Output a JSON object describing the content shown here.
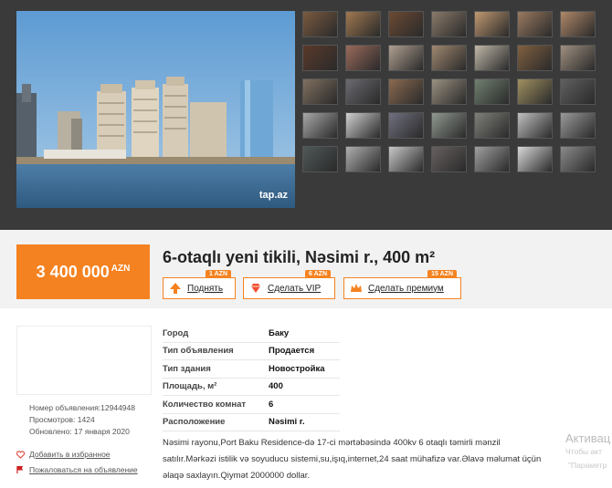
{
  "gallery": {
    "watermark": "tap.az",
    "thumb_colors": [
      "#7a5a40",
      "#a07850",
      "#6b4a33",
      "#8a7a6a",
      "#c09870",
      "#9a7a60",
      "#b08868",
      "#5a3a2a",
      "#9a6a5a",
      "#b0a090",
      "#a08870",
      "#c0b8a8",
      "#806040",
      "#a09080",
      "#807060",
      "#6a6a70",
      "#8a6a50",
      "#9a9080",
      "#708070",
      "#a09060",
      "#606060",
      "#a8a8a8",
      "#d0d0d0",
      "#707080",
      "#909890",
      "#80807a",
      "#c0c0c0",
      "#9a9a9a",
      "#505858",
      "#b0b0b0",
      "#c8c8c8",
      "#686060",
      "#a0a0a0",
      "#d8d8d8",
      "#8a8a8a"
    ]
  },
  "listing": {
    "price": "3 400 000",
    "currency": "AZN",
    "title": "6-otaqlı yeni tikili, Nəsimi r., 400 m²"
  },
  "promotions": {
    "raise": {
      "label": "Поднять",
      "badge": "1 AZN"
    },
    "vip": {
      "label": "Сделать VIP",
      "badge": "6 AZN"
    },
    "premium": {
      "label": "Сделать премиум",
      "badge": "15 AZN"
    }
  },
  "meta": {
    "ad_number": "Номер объявления:12944948",
    "views": "Просмотров: 1424",
    "updated": "Обновлено: 17 января 2020",
    "favorite": "Добавить в избранное",
    "report": "Пожаловаться на объявление"
  },
  "properties": [
    {
      "key": "Город",
      "value": "Баку"
    },
    {
      "key": "Тип объявления",
      "value": "Продается"
    },
    {
      "key": "Тип здания",
      "value": "Новостройка"
    },
    {
      "key": "Площадь, м²",
      "value": "400"
    },
    {
      "key": "Количество комнат",
      "value": "6"
    },
    {
      "key": "Расположение",
      "value": "Nəsimi r."
    }
  ],
  "description": {
    "line1": "Nəsimi rayonu,Port Baku Residence-də 17-ci mərtəbəsində 400kv 6 otaqlı təmirli mənzil",
    "line2": "satılır.Mərkəzi istilik və soyuducu sistemi,su,işıq,internet,24 saat mühafizə var.Əlavə məlumat üçün",
    "line3": "əlaqə saxlayın.Qiymət 2000000 dollar."
  },
  "overlay": {
    "title": "Активац",
    "line1": "Чтобы акт",
    "line2": "\"Параметр"
  },
  "colors": {
    "accent": "#f58220"
  }
}
